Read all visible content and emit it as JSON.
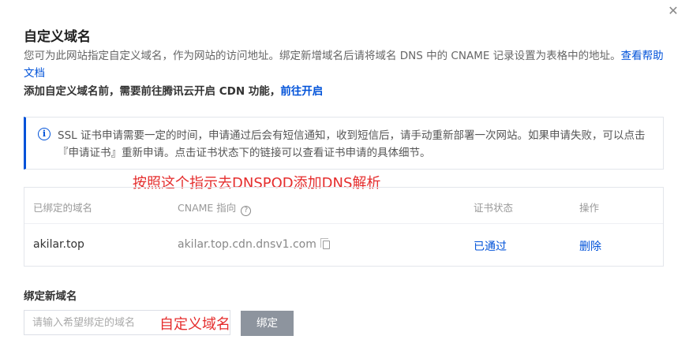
{
  "dialog": {
    "title": "自定义域名",
    "close_icon": "close-icon",
    "desc_text": "您可为此网站指定自定义域名，作为网站的访问地址。绑定新增域名后请将域名 DNS 中的 CNAME 记录设置为表格中的地址。",
    "desc_link": "查看帮助文档",
    "req_text": "添加自定义域名前，需要前往腾讯云开启 CDN 功能，",
    "req_link": "前往开启"
  },
  "notice": {
    "icon": "info-icon",
    "text": "SSL 证书申请需要一定的时间，申请通过后会有短信通知，收到短信后，请手动重新部署一次网站。如果申请失败，可以点击『申请证书』重新申请。点击证书状态下的链接可以查看证书申请的具体细节。"
  },
  "annotations": {
    "top": "按照这个指示去DNSPOD添加DNS解析",
    "bottom": "自定义域名"
  },
  "table": {
    "columns": [
      "已绑定的域名",
      "CNAME 指向",
      "证书状态",
      "操作"
    ],
    "rows": [
      {
        "domain": "akilar.top",
        "cname": "akilar.top.cdn.dnsv1.com",
        "status": "已通过",
        "action": "删除"
      }
    ]
  },
  "bind": {
    "title": "绑定新域名",
    "placeholder": "请输入希望绑定的域名",
    "button": "绑定"
  },
  "colors": {
    "link": "#0052d9",
    "annotation": "#e52d2d",
    "button_disabled": "#8d949e"
  }
}
